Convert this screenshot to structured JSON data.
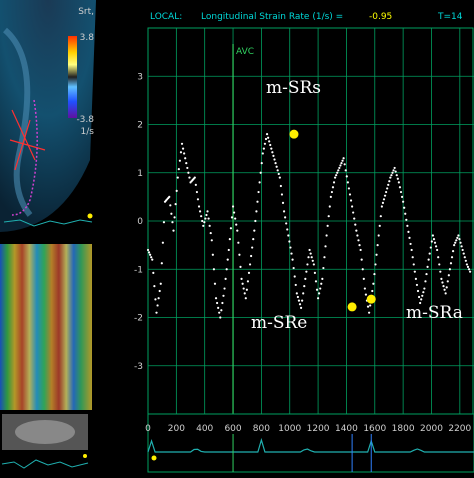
{
  "echo_panel": {
    "unit_label": "Srt,",
    "scale_max": "3.8",
    "scale_min": "-3.8",
    "scale_unit": "1/s"
  },
  "header": {
    "mode_label": "LOCAL:",
    "title": "Longitudinal Strain Rate (1/s) =",
    "value": "-0.95",
    "t_label": "T=14"
  },
  "markers": {
    "avc": "AVC"
  },
  "annotations": {
    "m_srs": "m-SRs",
    "m_sre": "m-SRe",
    "m_sra": "m-SRa"
  },
  "colors": {
    "header_text": "#00d8d8",
    "header_value": "#ffff00",
    "grid": "#00a060",
    "trace": "#ffffff",
    "peak_marker": "#ffee00",
    "avc_line": "#30d060",
    "timeline_trace": "#20b0b0"
  },
  "chart_data": {
    "type": "line",
    "title": "Longitudinal Strain Rate (1/s)",
    "xlabel": "",
    "ylabel": "",
    "ylim": [
      -4,
      4
    ],
    "yticks": [
      3,
      2,
      1,
      0,
      -1,
      -2,
      -3
    ],
    "xticks": [
      "0",
      "200",
      "400",
      "600",
      "800",
      "1000",
      "1200",
      "1400",
      "1600",
      "1800",
      "2000",
      "2200"
    ],
    "xlim": [
      0,
      2300
    ],
    "avc_time": 600,
    "series": [
      {
        "x": [
          0,
          30,
          60,
          90,
          120,
          150,
          180,
          210,
          240,
          270,
          300,
          330,
          360,
          390,
          420,
          450,
          480,
          510,
          540,
          570,
          600,
          630,
          660,
          690,
          720,
          750,
          780,
          810,
          840,
          870,
          900,
          930,
          960,
          990,
          1020,
          1050,
          1080,
          1110,
          1140,
          1170,
          1200,
          1230,
          1260,
          1290,
          1320,
          1350,
          1380,
          1410,
          1440,
          1470,
          1500,
          1530,
          1560,
          1590,
          1620,
          1650,
          1680,
          1710,
          1740,
          1770,
          1800,
          1830,
          1860,
          1890,
          1920,
          1950,
          1980,
          2010,
          2040,
          2070,
          2100,
          2130,
          2160,
          2190,
          2220,
          2250,
          2280
        ],
        "y": [
          -0.6,
          -0.8,
          -1.9,
          -1.3,
          0.4,
          0.5,
          -0.2,
          0.9,
          1.6,
          1.2,
          0.8,
          0.9,
          0.3,
          -0.1,
          0.2,
          -0.4,
          -1.6,
          -2.0,
          -1.4,
          -0.6,
          0.3,
          -0.2,
          -1.2,
          -1.6,
          -0.9,
          -0.2,
          0.6,
          1.4,
          1.8,
          1.5,
          1.2,
          0.9,
          0.2,
          -0.3,
          -0.8,
          -1.5,
          -1.8,
          -1.2,
          -0.6,
          -0.9,
          -1.6,
          -1.2,
          -0.3,
          0.5,
          0.9,
          1.1,
          1.3,
          0.8,
          0.3,
          -0.2,
          -0.6,
          -1.4,
          -1.9,
          -1.3,
          -0.5,
          0.3,
          0.6,
          0.9,
          1.1,
          0.8,
          0.4,
          -0.1,
          -0.6,
          -1.2,
          -1.7,
          -1.4,
          -0.8,
          -0.3,
          -0.6,
          -1.2,
          -1.5,
          -1.0,
          -0.5,
          -0.3,
          -0.6,
          -0.9,
          -1.1
        ]
      }
    ],
    "peaks": [
      {
        "label": "m-SRs",
        "x": 1030,
        "y": 1.8
      },
      {
        "label": "m-SRe",
        "x": 1440,
        "y": -1.78
      },
      {
        "label": "m-SRa",
        "x": 1575,
        "y": -1.62
      }
    ]
  }
}
